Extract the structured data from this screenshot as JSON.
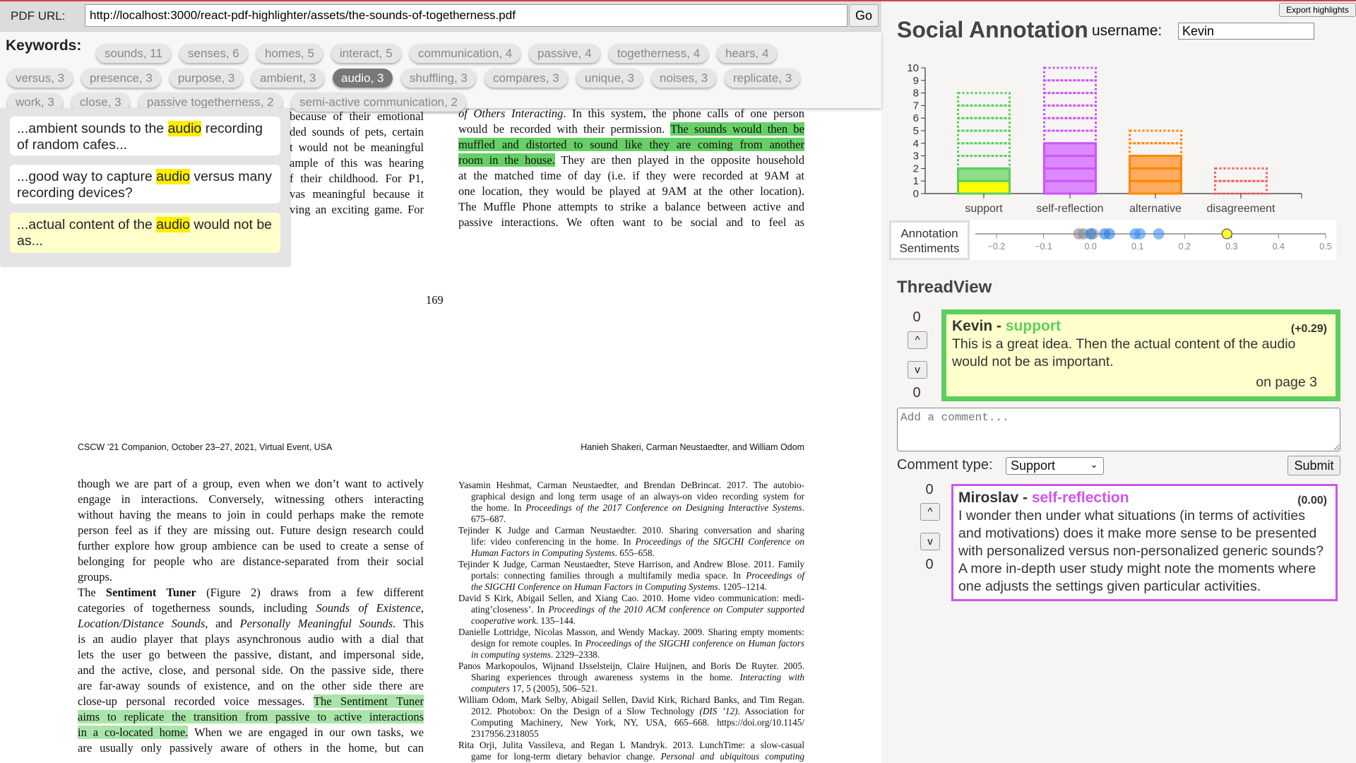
{
  "toolbar": {
    "url_label": "PDF URL:",
    "url": "http://localhost:3000/react-pdf-highlighter/assets/the-sounds-of-togetherness.pdf",
    "go": "Go"
  },
  "keywords": {
    "label": "Keywords:",
    "chips": [
      {
        "label": "sounds, 11"
      },
      {
        "label": "senses, 6"
      },
      {
        "label": "homes, 5"
      },
      {
        "label": "interact, 5"
      },
      {
        "label": "communication, 4"
      },
      {
        "label": "passive, 4"
      },
      {
        "label": "togetherness, 4"
      },
      {
        "label": "hears, 4"
      },
      {
        "label": "versus, 3"
      },
      {
        "label": "presence, 3"
      },
      {
        "label": "purpose, 3"
      },
      {
        "label": "ambient, 3"
      },
      {
        "label": "audio, 3",
        "active": true
      },
      {
        "label": "shuffling, 3"
      },
      {
        "label": "compares, 3"
      },
      {
        "label": "unique, 3"
      },
      {
        "label": "noises, 3"
      },
      {
        "label": "replicate, 3"
      },
      {
        "label": "work, 3"
      },
      {
        "label": "close, 3"
      },
      {
        "label": "passive togetherness, 2"
      },
      {
        "label": "semi-active communication, 2"
      }
    ]
  },
  "snippets": [
    {
      "before": "...ambient sounds to the ",
      "keyword": "audio",
      "after": " recording of random cafes..."
    },
    {
      "before": "...good way to capture ",
      "keyword": "audio",
      "after": " versus many recording devices?"
    },
    {
      "before": "...actual content of the ",
      "keyword": "audio",
      "after": " would not be as...",
      "selected": true
    }
  ],
  "pdf": {
    "page1_left_clipped": [
      "because of their emotional",
      "ded sounds of pets, certain",
      "t would not be meaningful",
      "ample of this was hearing",
      "f their childhood. For P1,",
      "vas meaningful because it",
      "ving an exciting game. For"
    ],
    "page1_right": [
      [
        [
          "of Others Interacting",
          "i"
        ],
        [
          ". In this system, the phone calls of one person",
          ""
        ]
      ],
      [
        [
          "would be recorded with their permission. ",
          ""
        ],
        [
          "The sounds would then be",
          "h"
        ]
      ],
      [
        [
          "muffled and distorted to sound like they are coming from another",
          "h"
        ]
      ],
      [
        [
          "room in the house.",
          "h"
        ],
        [
          " They are then played in the opposite household",
          ""
        ]
      ],
      [
        [
          "at the matched time of day (i.e. if they were recorded at 9AM at",
          ""
        ]
      ],
      [
        [
          "one location, they would be played at 9AM at the other location).",
          ""
        ]
      ],
      [
        [
          "The Muffle Phone attempts to strike a balance between active and",
          ""
        ]
      ],
      [
        [
          "passive interactions. We often want to be social and to feel as",
          ""
        ]
      ]
    ],
    "page_number": "169",
    "header_left": "CSCW ’21 Companion, October 23–27, 2021, Virtual Event, USA",
    "header_right": "Hanieh Shakeri, Carman Neustaedter, and William Odom",
    "page2_left": [
      [
        [
          "though we are part of a group, even when we don’t want to actively",
          ""
        ]
      ],
      [
        [
          "engage in interactions. Conversely, witnessing others interacting",
          ""
        ]
      ],
      [
        [
          "without having the means to join in could perhaps make the remote",
          ""
        ]
      ],
      [
        [
          "person feel as if they are missing out. Future design research could",
          ""
        ]
      ],
      [
        [
          "further explore how group ambience can be used to create a sense of",
          ""
        ]
      ],
      [
        [
          "belonging for people who are distance-separated from their social",
          ""
        ]
      ],
      [
        [
          "groups.",
          "",
          true
        ]
      ],
      [
        [
          "    The ",
          ""
        ],
        [
          "Sentiment Tuner",
          "b"
        ],
        [
          " (Figure 2) draws from a few different",
          ""
        ]
      ],
      [
        [
          "categories of togetherness sounds, including ",
          ""
        ],
        [
          "Sounds of Existence",
          "i"
        ],
        [
          ",",
          ""
        ]
      ],
      [
        [
          "Location/Distance Sounds",
          "i"
        ],
        [
          ", and ",
          ""
        ],
        [
          "Personally Meaningful Sounds",
          "i"
        ],
        [
          ". This",
          ""
        ]
      ],
      [
        [
          "is an audio player that plays asynchronous audio with a dial that",
          ""
        ]
      ],
      [
        [
          "lets the user go between the passive, distant, and impersonal side,",
          ""
        ]
      ],
      [
        [
          "and the active, close, and personal side. On the passive side, there",
          ""
        ]
      ],
      [
        [
          "are far-away sounds of existence, and on the other side there are",
          ""
        ]
      ],
      [
        [
          "close-up personal recorded voice messages. ",
          ""
        ],
        [
          "The Sentiment Tuner",
          "h"
        ]
      ],
      [
        [
          "aims to replicate the transition from passive to active interactions",
          "h"
        ]
      ],
      [
        [
          "in a co-located home.",
          "h"
        ],
        [
          " When we are engaged in our own tasks, we",
          ""
        ]
      ],
      [
        [
          "are usually only passively aware of others in the home, but can",
          ""
        ]
      ]
    ],
    "references": [
      [
        [
          "Yasamin Heshmat, Carman Neustaedter, and Brendan DeBrincat. 2017.  The autobio-",
          ""
        ]
      ],
      [
        [
          "graphical design and long term usage of an always-on video recording system for",
          ""
        ]
      ],
      [
        [
          "the home. In ",
          ""
        ],
        [
          "Proceedings of the 2017 Conference on Designing Interactive Systems",
          "i"
        ],
        [
          ".",
          ""
        ]
      ],
      [
        [
          "675–687.",
          "",
          true
        ]
      ],
      [
        [
          "Tejinder K Judge and Carman Neustaedter. 2010.  Sharing conversation and sharing",
          ""
        ]
      ],
      [
        [
          "life: video conferencing in the home. In ",
          ""
        ],
        [
          "Proceedings of the SIGCHI Conference on",
          "i"
        ]
      ],
      [
        [
          "Human Factors in Computing Systems",
          "i"
        ],
        [
          ". 655–658.",
          "",
          true
        ]
      ],
      [
        [
          "Tejinder K Judge, Carman Neustaedter, Steve Harrison, and Andrew Blose. 2011. Family",
          ""
        ]
      ],
      [
        [
          "portals: connecting families through a multifamily media space. In ",
          ""
        ],
        [
          "Proceedings of",
          "i"
        ]
      ],
      [
        [
          "the SIGCHI Conference on Human Factors in Computing Systems",
          "i"
        ],
        [
          ". 1205–1214.",
          "",
          true
        ]
      ],
      [
        [
          "David S Kirk, Abigail Sellen, and Xiang Cao. 2010.  Home video communication: medi-",
          ""
        ]
      ],
      [
        [
          "ating’closeness’. In ",
          ""
        ],
        [
          "Proceedings of the 2010 ACM conference on Computer supported",
          "i"
        ]
      ],
      [
        [
          "cooperative work",
          "i"
        ],
        [
          ". 135–144.",
          "",
          true
        ]
      ],
      [
        [
          "Danielle Lottridge, Nicolas Masson, and Wendy Mackay. 2009. Sharing empty moments:",
          ""
        ]
      ],
      [
        [
          "design for remote couples. In ",
          ""
        ],
        [
          "Proceedings of the SIGCHI conference on Human factors",
          "i"
        ]
      ],
      [
        [
          "in computing systems",
          "i"
        ],
        [
          ". 2329–2338.",
          "",
          true
        ]
      ],
      [
        [
          "Panos Markopoulos, Wijnand IJsselsteijn, Claire Huijnen, and Boris De Ruyter. 2005.",
          ""
        ]
      ],
      [
        [
          "Sharing experiences through awareness systems in the home.  ",
          ""
        ],
        [
          "Interacting with",
          "i"
        ]
      ],
      [
        [
          "computers",
          "i"
        ],
        [
          " 17, 5 (2005), 506–521.",
          "",
          true
        ]
      ],
      [
        [
          "William Odom, Mark Selby, Abigail Sellen, David Kirk, Richard Banks, and Tim Regan.",
          ""
        ]
      ],
      [
        [
          "2012.  Photobox: On the Design of a Slow Technology ",
          ""
        ],
        [
          "(DIS ’12)",
          "i"
        ],
        [
          ". Association for",
          ""
        ]
      ],
      [
        [
          "Computing Machinery, New York, NY, USA, 665–668.   https://doi.org/10.1145/",
          ""
        ]
      ],
      [
        [
          "2317956.2318055",
          "",
          true
        ]
      ],
      [
        [
          "Rita Orji, Julita Vassileva, and Regan L Mandryk. 2013.  LunchTime: a slow-casual",
          ""
        ]
      ],
      [
        [
          "game for long-term dietary behavior change. ",
          ""
        ],
        [
          "Personal and ubiquitous computing",
          "i"
        ]
      ]
    ],
    "reference_indent": [
      0,
      1,
      1,
      1,
      0,
      1,
      1,
      0,
      1,
      1,
      0,
      1,
      1,
      0,
      1,
      1,
      0,
      1,
      1,
      0,
      1,
      1,
      1,
      0,
      1
    ]
  },
  "panel": {
    "title": "Social Annotation",
    "username_label": "username:",
    "username": "Kevin",
    "export": "Export highlights"
  },
  "chart_data": {
    "type": "bar",
    "categories": [
      "support",
      "self-reflection",
      "alternative",
      "disagreement"
    ],
    "ylim": [
      0,
      10
    ],
    "yticks": [
      "0",
      "1",
      "2",
      "3",
      "4",
      "5",
      "6",
      "7",
      "8",
      "9",
      "10"
    ],
    "series": [
      {
        "category": "support",
        "count": 2,
        "total": 8,
        "highlighted": 1,
        "stroke": "#5ccf5c",
        "fill": "#8fdc8a"
      },
      {
        "category": "self-reflection",
        "count": 4,
        "total": 10,
        "highlighted": 0,
        "stroke": "#cc55ff",
        "fill": "#dd88ff"
      },
      {
        "category": "alternative",
        "count": 3,
        "total": 5,
        "highlighted": 0,
        "stroke": "#ff8800",
        "fill": "#ffab60"
      },
      {
        "category": "disagreement",
        "count": 0,
        "total": 2,
        "highlighted": 0,
        "stroke": "#ff5f5f",
        "fill": "#ff9f9f"
      }
    ],
    "highlight_color": "#ffff00"
  },
  "sentiments": {
    "label_line1": "Annotation",
    "label_line2": "Sentiments",
    "ticks": [
      "−0.2",
      "−0.1",
      "0.0",
      "0.1",
      "0.2",
      "0.3",
      "0.4",
      "0.5"
    ],
    "range": [
      -0.25,
      0.5
    ],
    "points": [
      {
        "value": -0.025,
        "color": "#888888"
      },
      {
        "value": -0.015,
        "color": "#888888"
      },
      {
        "value": 0.005,
        "color": "#888888"
      },
      {
        "value": 0.0,
        "color": "#2a7de1"
      },
      {
        "value": 0.03,
        "color": "#2a7de1"
      },
      {
        "value": 0.04,
        "color": "#2a7de1"
      },
      {
        "value": 0.095,
        "color": "#3b8ff0"
      },
      {
        "value": 0.105,
        "color": "#3b8ff0"
      },
      {
        "value": 0.145,
        "color": "#3b8ff0"
      },
      {
        "value": 0.29,
        "color": "#ffff33",
        "selected": true
      }
    ]
  },
  "thread": {
    "title": "ThreadView",
    "comments": [
      {
        "up_count": "0",
        "down_count": "0",
        "up": "^",
        "down": "v",
        "author": "Kevin",
        "sep": " - ",
        "type": "support",
        "type_color": "#5ccf5c",
        "score": "(+0.29)",
        "text": "This is a great idea. Then the actual content of the audio would not be as important.",
        "page": "on page 3"
      },
      {
        "up_count": "0",
        "down_count": "0",
        "up": "^",
        "down": "v",
        "author": "Miroslav",
        "sep": " - ",
        "type": "self-reflection",
        "type_color": "#cc55ee",
        "score": "(0.00)",
        "text": "I wonder then under what situations (in terms of activities and motivations) does it make more sense to be presented with personalized versus non-personalized generic sounds? A more in-depth user study might note the moments where one adjusts the settings given particular activities."
      }
    ],
    "comment_placeholder": "Add a comment...",
    "comment_type_label": "Comment type:",
    "comment_type": "Support",
    "submit": "Submit"
  }
}
